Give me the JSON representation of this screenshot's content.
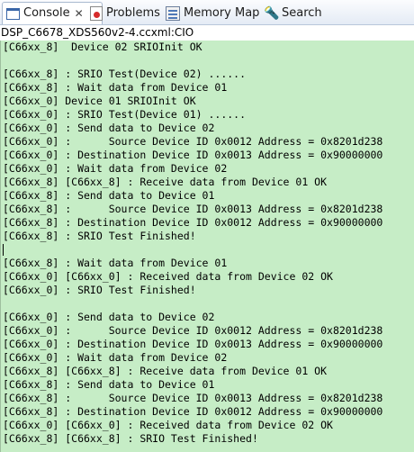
{
  "tabs": [
    {
      "label": "Console",
      "icon": "console-icon",
      "active": true
    },
    {
      "label": "Problems",
      "icon": "problems-icon"
    },
    {
      "label": "Memory Map",
      "icon": "memory-map-icon"
    },
    {
      "label": "Search",
      "icon": "search-icon"
    }
  ],
  "close_glyph": "✕",
  "console_path": "DSP_C6678_XDS560v2-4.ccxml:CIO",
  "lines": [
    "[C66xx_8]  Device 02 SRIOInit OK",
    "",
    "[C66xx_8] : SRIO Test(Device 02) ......",
    "[C66xx_8] : Wait data from Device 01",
    "[C66xx_0] Device 01 SRIOInit OK",
    "[C66xx_0] : SRIO Test(Device 01) ......",
    "[C66xx_0] : Send data to Device 02",
    "[C66xx_0] :      Source Device ID 0x0012 Address = 0x8201d238",
    "[C66xx_0] : Destination Device ID 0x0013 Address = 0x90000000",
    "[C66xx_0] : Wait data from Device 02",
    "[C66xx_8] [C66xx_8] : Receive data from Device 01 OK",
    "[C66xx_8] : Send data to Device 01",
    "[C66xx_8] :      Source Device ID 0x0013 Address = 0x8201d238",
    "[C66xx_8] : Destination Device ID 0x0012 Address = 0x90000000",
    "[C66xx_8] : SRIO Test Finished!",
    "",
    "[C66xx_8] : Wait data from Device 01",
    "[C66xx_0] [C66xx_0] : Received data from Device 02 OK",
    "[C66xx_0] : SRIO Test Finished!",
    "",
    "[C66xx_0] : Send data to Device 02",
    "[C66xx_0] :      Source Device ID 0x0012 Address = 0x8201d238",
    "[C66xx_0] : Destination Device ID 0x0013 Address = 0x90000000",
    "[C66xx_0] : Wait data from Device 02",
    "[C66xx_8] [C66xx_8] : Receive data from Device 01 OK",
    "[C66xx_8] : Send data to Device 01",
    "[C66xx_8] :      Source Device ID 0x0013 Address = 0x8201d238",
    "[C66xx_8] : Destination Device ID 0x0012 Address = 0x90000000",
    "[C66xx_0] [C66xx_0] : Received data from Device 02 OK",
    "[C66xx_8] [C66xx_8] : SRIO Test Finished!"
  ],
  "colors": {
    "console_background": "#c6edc6",
    "tab_active_background": "#ffffff",
    "tab_bar_background": "#e4ebf5"
  }
}
